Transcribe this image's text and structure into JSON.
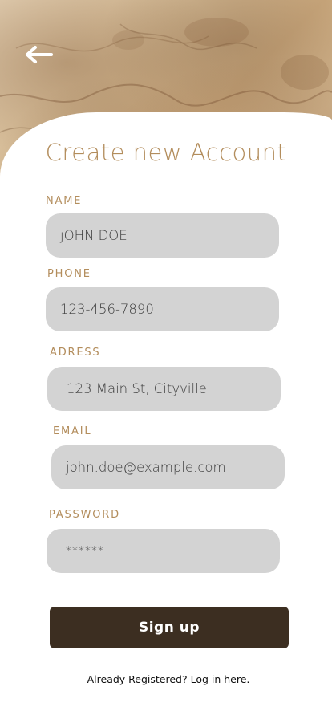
{
  "header": {
    "back_icon": "arrow-left-icon",
    "title": "Create new Account"
  },
  "form": {
    "name": {
      "label": "NAME",
      "value": "jOHN DOE"
    },
    "phone": {
      "label": "PHONE",
      "value": "123-456-7890"
    },
    "address": {
      "label": "ADRESS",
      "value": "123 Main St, Cityville"
    },
    "email": {
      "label": "EMAIL",
      "value": "john.doe@example.com"
    },
    "password": {
      "label": "PASSWORD",
      "value": "******"
    }
  },
  "actions": {
    "signup_label": "Sign up",
    "login_link": "Already Registered? Log in here."
  },
  "colors": {
    "accent": "#b38d5c",
    "button": "#3c2e21",
    "field_bg": "#d3d3d3"
  }
}
